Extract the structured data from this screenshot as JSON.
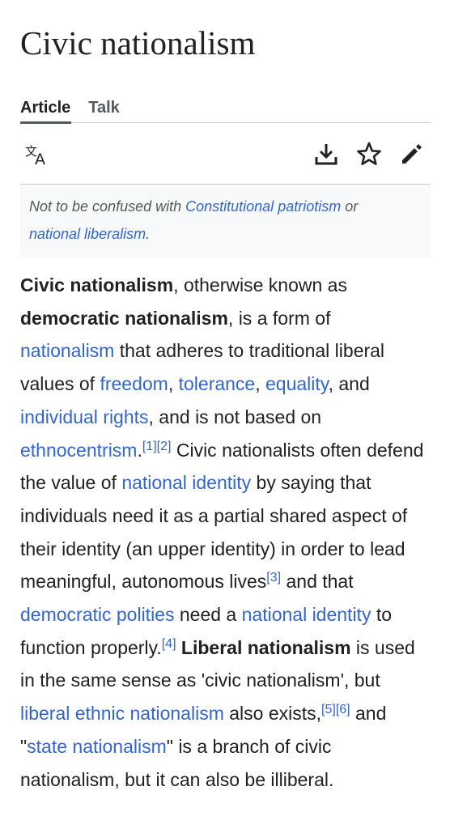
{
  "page": {
    "title": "Civic nationalism"
  },
  "tabs": [
    {
      "label": "Article",
      "active": true
    },
    {
      "label": "Talk",
      "active": false
    }
  ],
  "toolbar": {
    "icons": [
      "language-icon",
      "download-icon",
      "star-icon",
      "edit-icon"
    ]
  },
  "hatnote": {
    "prefix": "Not to be confused with ",
    "link1": "Constitutional patriotism",
    "middle": " or",
    "link2": "national liberalism",
    "suffix": "."
  },
  "article": {
    "t1_bold": "Civic nationalism",
    "t2": ", otherwise known as",
    "t3_bold": "democratic nationalism",
    "t4": ", is a form of",
    "l_nationalism": "nationalism",
    "t5": " that adheres to traditional liberal values of ",
    "l_freedom": "freedom",
    "t6": ", ",
    "l_tolerance": "tolerance",
    "t7": ", ",
    "l_equality": "equality",
    "t8": ", and",
    "l_individual_rights": "individual rights",
    "t9": ", and is not based on",
    "l_ethnocentrism": "ethnocentrism",
    "t10": ".",
    "ref1": "[1]",
    "ref2": "[2]",
    "t11": " Civic nationalists often defend the value of ",
    "l_national_identity": "national identity",
    "t12": " by saying that individuals need it as a partial shared aspect of their identity (an upper identity) in order to lead meaningful, autonomous lives",
    "ref3": "[3]",
    "t13": " and that ",
    "l_democratic_polities": "democratic polities",
    "t14": " need a ",
    "l_national_identity2": "national identity",
    "t15": " to function properly.",
    "ref4": "[4]",
    "t16": " ",
    "t17_bold": "Liberal nationalism",
    "t18": " is used in the same sense as 'civic nationalism', but ",
    "l_liberal_ethnic": "liberal ethnic nationalism",
    "t19": " also exists,",
    "ref5": "[5]",
    "ref6": "[6]",
    "t20": " and \"",
    "l_state_nationalism": "state nationalism",
    "t21": "\" is a branch of civic nationalism, but it can also be illiberal."
  },
  "colors": {
    "link": "#3366cc",
    "text": "#202122",
    "muted": "#54595d",
    "hatnote_bg": "#f8f9fa"
  }
}
